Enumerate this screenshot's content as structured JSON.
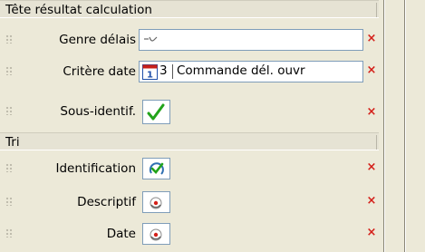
{
  "section_result_header": {
    "title": "Tête résultat calculation"
  },
  "section_sort": {
    "title": "Tri"
  },
  "rows": {
    "genre_delais": {
      "label": "Genre délais",
      "icon": "wave-indicator-icon"
    },
    "critere_date": {
      "label": "Critère date",
      "icon": "calendar-icon",
      "number": "3",
      "description": "Commande dél. ouvr"
    },
    "sous_identif": {
      "label": "Sous-identif.",
      "icon": "checkmark-icon"
    },
    "identification": {
      "label": "Identification",
      "icon": "refresh-check-icon"
    },
    "descriptif": {
      "label": "Descriptif",
      "icon": "radio-dot-icon"
    },
    "date": {
      "label": "Date",
      "icon": "radio-dot-icon"
    }
  },
  "remove_symbol": "×",
  "colors": {
    "remove": "#d4201a",
    "panel_bg": "#ece9d8",
    "field_border": "#7f9db9",
    "check_green": "#22a31a"
  }
}
